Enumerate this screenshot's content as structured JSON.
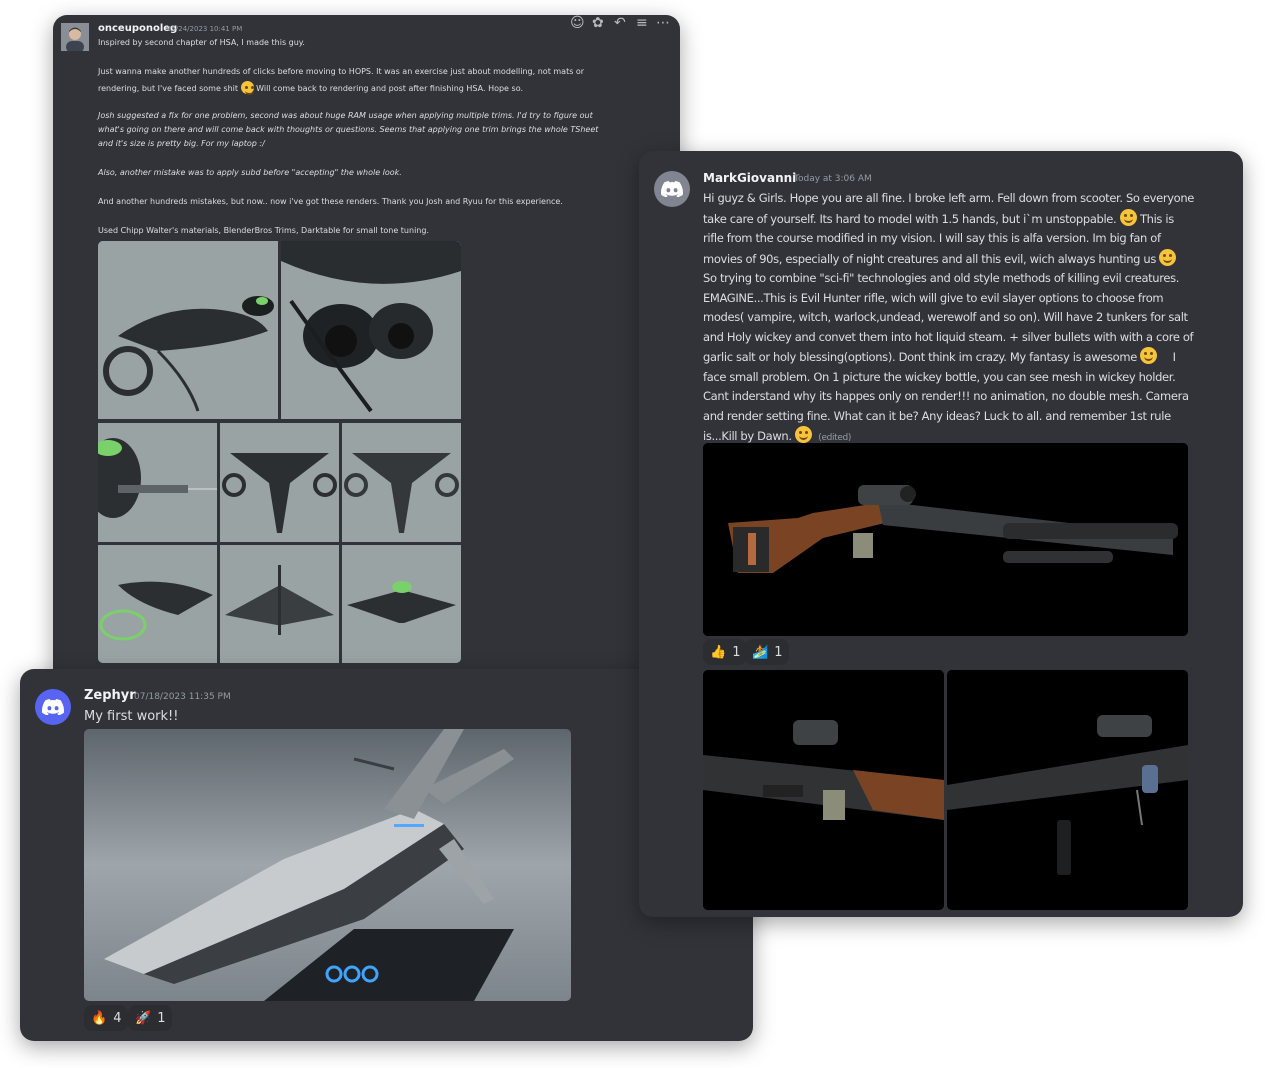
{
  "card1": {
    "username": "onceuponoleg",
    "timestamp": "05/24/2023 10:41 PM",
    "avatar_icon": "user-photo-avatar",
    "lines": [
      "Inspired by second chapter of HSA, I made this guy.",
      "Just wanna make another hundreds of clicks before moving to HOPS. It was an exercise just about modelling, not mats or",
      "rendering, but I've faced some shit",
      "Will come back to rendering and post after finishing HSA. Hope so.",
      "Josh suggested a fix for one problem, second was about huge RAM usage when applying multiple trims. I'd try to figure out",
      "what's going on there and will come back with thoughts or questions. Seems that applying one trim brings the whole TSheet",
      "and it's size is pretty big. For my laptop :/",
      "Also, another mistake was to apply subd before \"accepting\" the whole look.",
      "And another hundreds mistakes, but now.. now i've got these renders. Thank you Josh and Ryuu for this experience.",
      "Used Chipp Walter's materials, BlenderBros Trims, Darktable for small tone tuning."
    ],
    "toolbar_icons": [
      "add-reaction-icon",
      "emoji-icon",
      "reply-icon",
      "thread-icon",
      "more-icon"
    ],
    "render_alt": "Sci-fi ship render grid"
  },
  "card2": {
    "username": "MarkGiovanni",
    "timestamp": "Today at 3:06 AM",
    "lines": [
      "Hi guyz & Girls. Hope you are all fine. I broke left arm. Fell down from scooter. So everyone",
      "take care of yourself. Its hard to model with 1.5 hands, but i`m unstoppable.",
      "This is",
      "rifle from the course modified in my vision. I will say this is alfa version. Im big fan of",
      "movies of 90s, especially of night creatures and all this evil, wich always hunting us",
      "So trying to combine \"sci-fi\" technologies and old style methods of killing evil creatures.",
      "EMAGINE...This is Evil Hunter rifle, wich will give to evil slayer options to choose from",
      "modes( vampire, witch, warlock,undead, werewolf and so on). Will have 2 tunkers for salt",
      "and Holy wickey and convet them into hot liquid steam. + silver bullets with with a core of",
      "garlic salt or holy blessing(options).  Dont think im crazy. My fantasy is awesome",
      "I",
      "face small problem. On 1 picture the wickey bottle, you can see mesh in wickey holder.",
      "Cant inderstand why its happes only on render!!! no animation, no double mesh. Camera",
      "and render setting fine. What can it be? Any ideas?  Luck to all. and remember 1st rule",
      "is...Kill by Dawn."
    ],
    "edited": "(edited)",
    "reactions": [
      {
        "icon": "thumbs-up-icon",
        "glyph": "👍",
        "count": "1"
      },
      {
        "icon": "surfer-icon",
        "glyph": "🏄",
        "count": "1"
      }
    ]
  },
  "card3": {
    "username": "Zephyr",
    "timestamp": "07/18/2023 11:35 PM",
    "message": "My first work!!",
    "reactions": [
      {
        "icon": "fire-icon",
        "glyph": "🔥",
        "count": "4"
      },
      {
        "icon": "rocket-icon",
        "glyph": "🚀",
        "count": "1"
      }
    ]
  },
  "colors": {
    "card_bg": "#313338",
    "blurple": "#5865f2",
    "username": "#f2f3f5",
    "timestamp": "#949ba4"
  }
}
